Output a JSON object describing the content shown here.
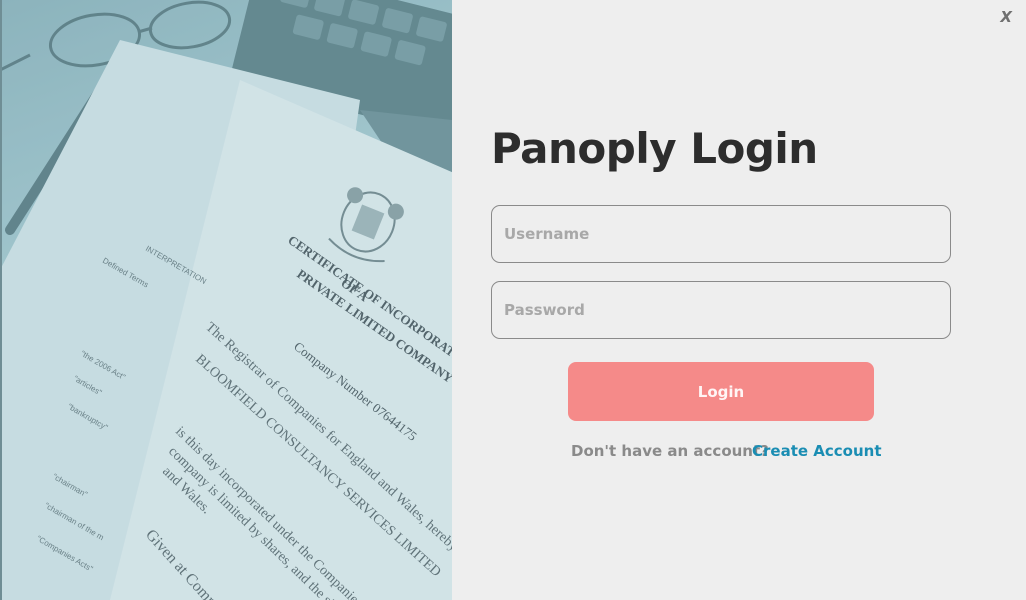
{
  "window": {
    "close_label": "X"
  },
  "photo": {
    "cert_heading_1": "CERTIFICATE OF INCORPORATION",
    "cert_heading_2": "OF A",
    "cert_heading_3": "PRIVATE LIMITED COMPANY",
    "company_number": "Company Number 07644175",
    "body_line_1": "The Registrar of Companies for England and Wales, hereby certifies",
    "body_line_2": "BLOOMFIELD CONSULTANCY SERVICES LIMITED",
    "body_line_3": "is this day incorporated under the Companies",
    "body_line_4": "company is limited by shares, and the si",
    "body_line_5": "and Wales.",
    "body_line_6": "Given at Comp",
    "back_page_heading": "INTERPRETATION",
    "back_page_terms": "Defined Terms",
    "back_page_quote_1": "\"articles\"",
    "back_page_quote_2": "\"bankruptcy\"",
    "back_page_quote_3": "\"chairman\"",
    "back_page_quote_4": "\"chairman of the m",
    "back_page_quote_5": "\"Companies Acts\"",
    "back_page_quote_6": "\"the 2006 Act\""
  },
  "login": {
    "title": "Panoply Login",
    "username_placeholder": "Username",
    "username_value": "",
    "password_placeholder": "Password",
    "password_value": "",
    "login_button": "Login",
    "signup_prompt": "Don't have an account?",
    "signup_link": "Create Account"
  },
  "colors": {
    "background": "#eeeeee",
    "title": "#2d2d2d",
    "login_button_bg": "#f58a89",
    "link": "#1a8db3"
  }
}
